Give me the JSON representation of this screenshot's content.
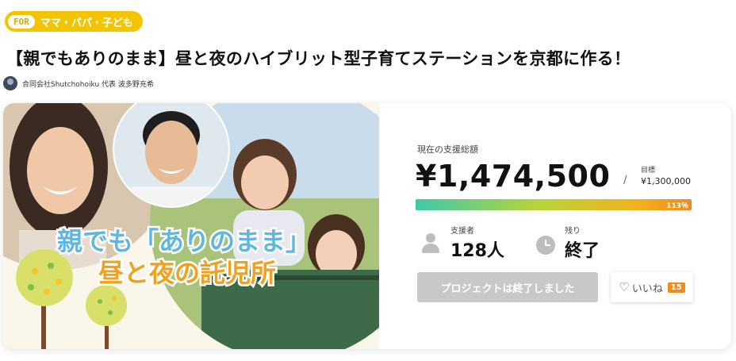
{
  "category": {
    "for_label": "FOR",
    "target": "ママ・パパ・子ども"
  },
  "project": {
    "title": "【親でもありのまま】昼と夜のハイブリット型子育てステーションを京都に作る！",
    "owner": "合同会社Shutchohoiku 代表 波多野充希",
    "hero_text_line1": "親でも「ありのまま」",
    "hero_text_line2": "昼と夜の託児所"
  },
  "funding": {
    "total_label": "現在の支援総額",
    "amount": "¥1,474,500",
    "slash": "/",
    "goal_label": "目標",
    "goal_amount": "¥1,300,000",
    "percent_text": "113％",
    "percent": 113
  },
  "stats": {
    "backers_label": "支援者",
    "backers_value": "128人",
    "remaining_label": "残り",
    "remaining_value": "終了"
  },
  "actions": {
    "ended_label": "プロジェクトは終了しました",
    "like_label": "いいね",
    "like_count": "15",
    "heart_icon": "heart-outline-icon"
  },
  "colors": {
    "tag_yellow": "#f5c400",
    "progress_start": "#3fc8a9",
    "progress_end": "#f08a1c",
    "count_badge": "#f08a1c",
    "ended_button": "#c8c8c8"
  }
}
